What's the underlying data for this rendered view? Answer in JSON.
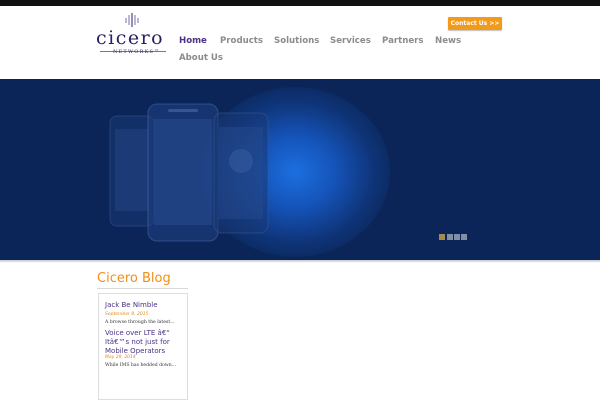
{
  "brand": {
    "name": "cicero",
    "subtitle": "NETWORKS™",
    "accent": "#f39a1a",
    "primary": "#4a3286",
    "hero_bg": "#0b2558"
  },
  "header": {
    "contact_label": "Contact Us >>"
  },
  "nav": {
    "items": [
      {
        "label": "Home",
        "active": true
      },
      {
        "label": "Products"
      },
      {
        "label": "Solutions"
      },
      {
        "label": "Services"
      },
      {
        "label": "Partners"
      },
      {
        "label": "News"
      },
      {
        "label": "About Us"
      }
    ]
  },
  "hero": {
    "slides_count": 4,
    "active_slide": 1
  },
  "blog": {
    "title": "Cicero Blog",
    "posts": [
      {
        "title": "Jack Be Nimble",
        "date": "September 8, 2015",
        "excerpt": "A browse through the latest..."
      },
      {
        "title": "Voice over LTE â€“ Itâ€™s not just for Mobile Operators",
        "date": "May 29, 2014",
        "excerpt": "While IMS has bedded down..."
      }
    ]
  }
}
